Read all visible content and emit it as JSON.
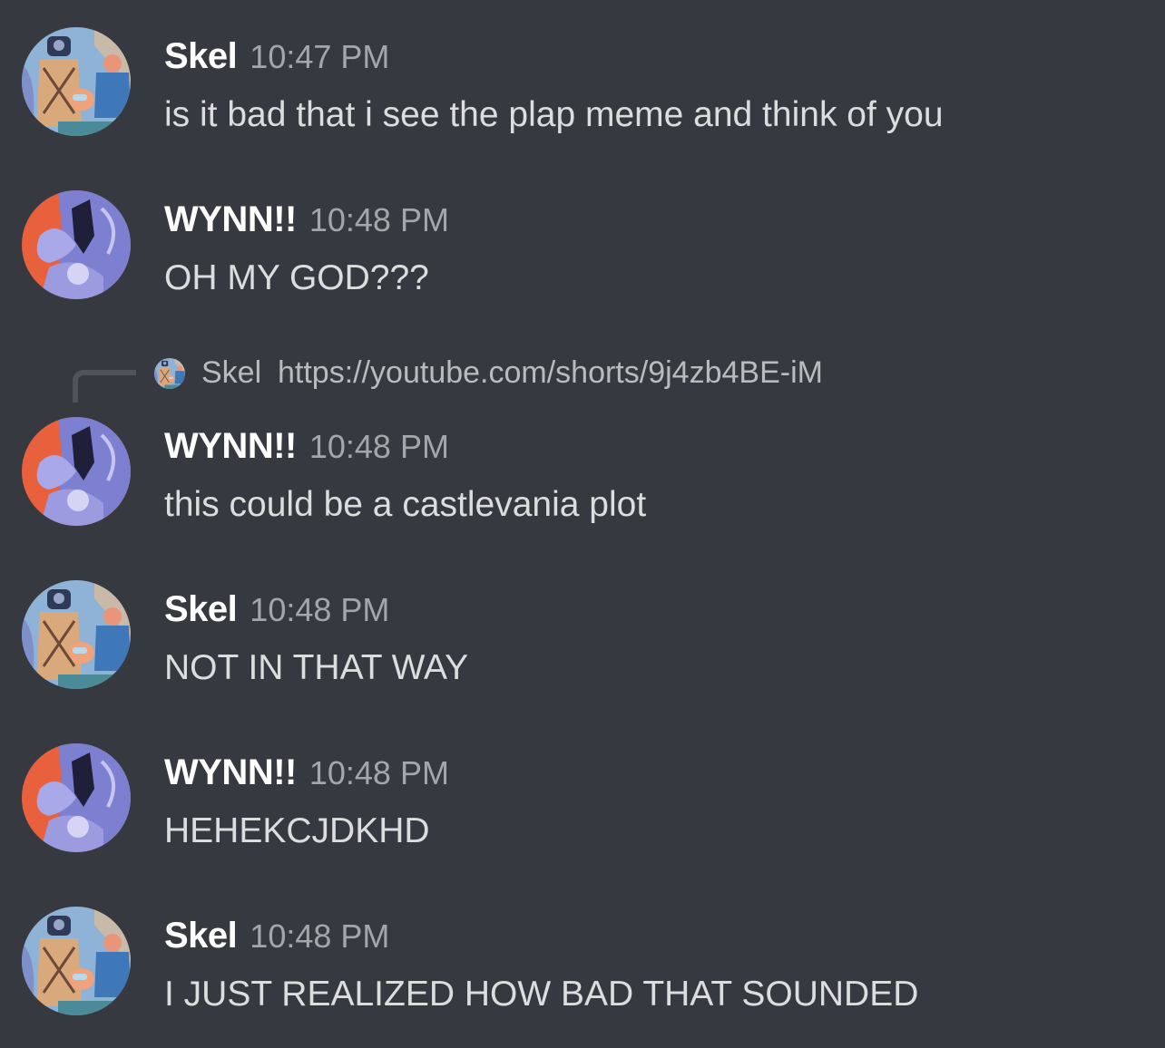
{
  "colors": {
    "background": "#36393f",
    "author": "#ffffff",
    "timestamp": "#a3a6aa",
    "content": "#dcddde",
    "reply_line": "#4f545c"
  },
  "messages": [
    {
      "author": "Skel",
      "time": "10:47 PM",
      "text": "is it bad that i see the plap meme and think of you",
      "avatar": "skel-avatar"
    },
    {
      "author": "WYNN!!",
      "time": "10:48 PM",
      "text": "OH MY GOD???",
      "avatar": "wynn-avatar"
    },
    {
      "author": "WYNN!!",
      "time": "10:48 PM",
      "text": "this could be a castlevania plot",
      "avatar": "wynn-avatar",
      "reply": {
        "author": "Skel",
        "text": "https://youtube.com/shorts/9j4zb4BE-iM"
      }
    },
    {
      "author": "Skel",
      "time": "10:48 PM",
      "text": "NOT IN THAT WAY",
      "avatar": "skel-avatar"
    },
    {
      "author": "WYNN!!",
      "time": "10:48 PM",
      "text": "HEHEKCJDKHD",
      "avatar": "wynn-avatar"
    },
    {
      "author": "Skel",
      "time": "10:48 PM",
      "text": "I JUST REALIZED HOW BAD THAT SOUNDED",
      "avatar": "skel-avatar"
    }
  ]
}
